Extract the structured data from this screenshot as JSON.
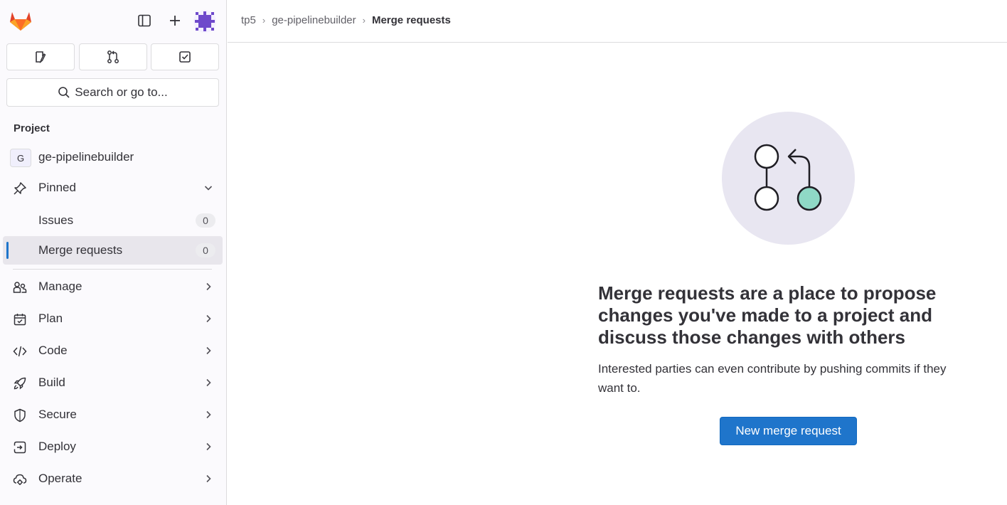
{
  "sidebar": {
    "quick_actions": [
      "issues-icon",
      "merge-request-icon",
      "todo-icon"
    ],
    "search_placeholder": "Search or go to...",
    "section_label": "Project",
    "project": {
      "initial": "G",
      "name": "ge-pipelinebuilder"
    },
    "pinned": {
      "label": "Pinned",
      "items": [
        {
          "label": "Issues",
          "count": "0"
        },
        {
          "label": "Merge requests",
          "count": "0"
        }
      ]
    },
    "nav": [
      {
        "label": "Manage"
      },
      {
        "label": "Plan"
      },
      {
        "label": "Code"
      },
      {
        "label": "Build"
      },
      {
        "label": "Secure"
      },
      {
        "label": "Deploy"
      },
      {
        "label": "Operate"
      }
    ]
  },
  "breadcrumb": {
    "items": [
      "tp5",
      "ge-pipelinebuilder",
      "Merge requests"
    ]
  },
  "empty_state": {
    "title": "Merge requests are a place to propose changes you've made to a project and discuss those changes with others",
    "description": "Interested parties can even contribute by pushing commits if they want to.",
    "button": "New merge request"
  },
  "colors": {
    "accent": "#1f75cb",
    "illustration_bg": "#e8e6f1",
    "illustration_green": "#8fd9c6"
  }
}
